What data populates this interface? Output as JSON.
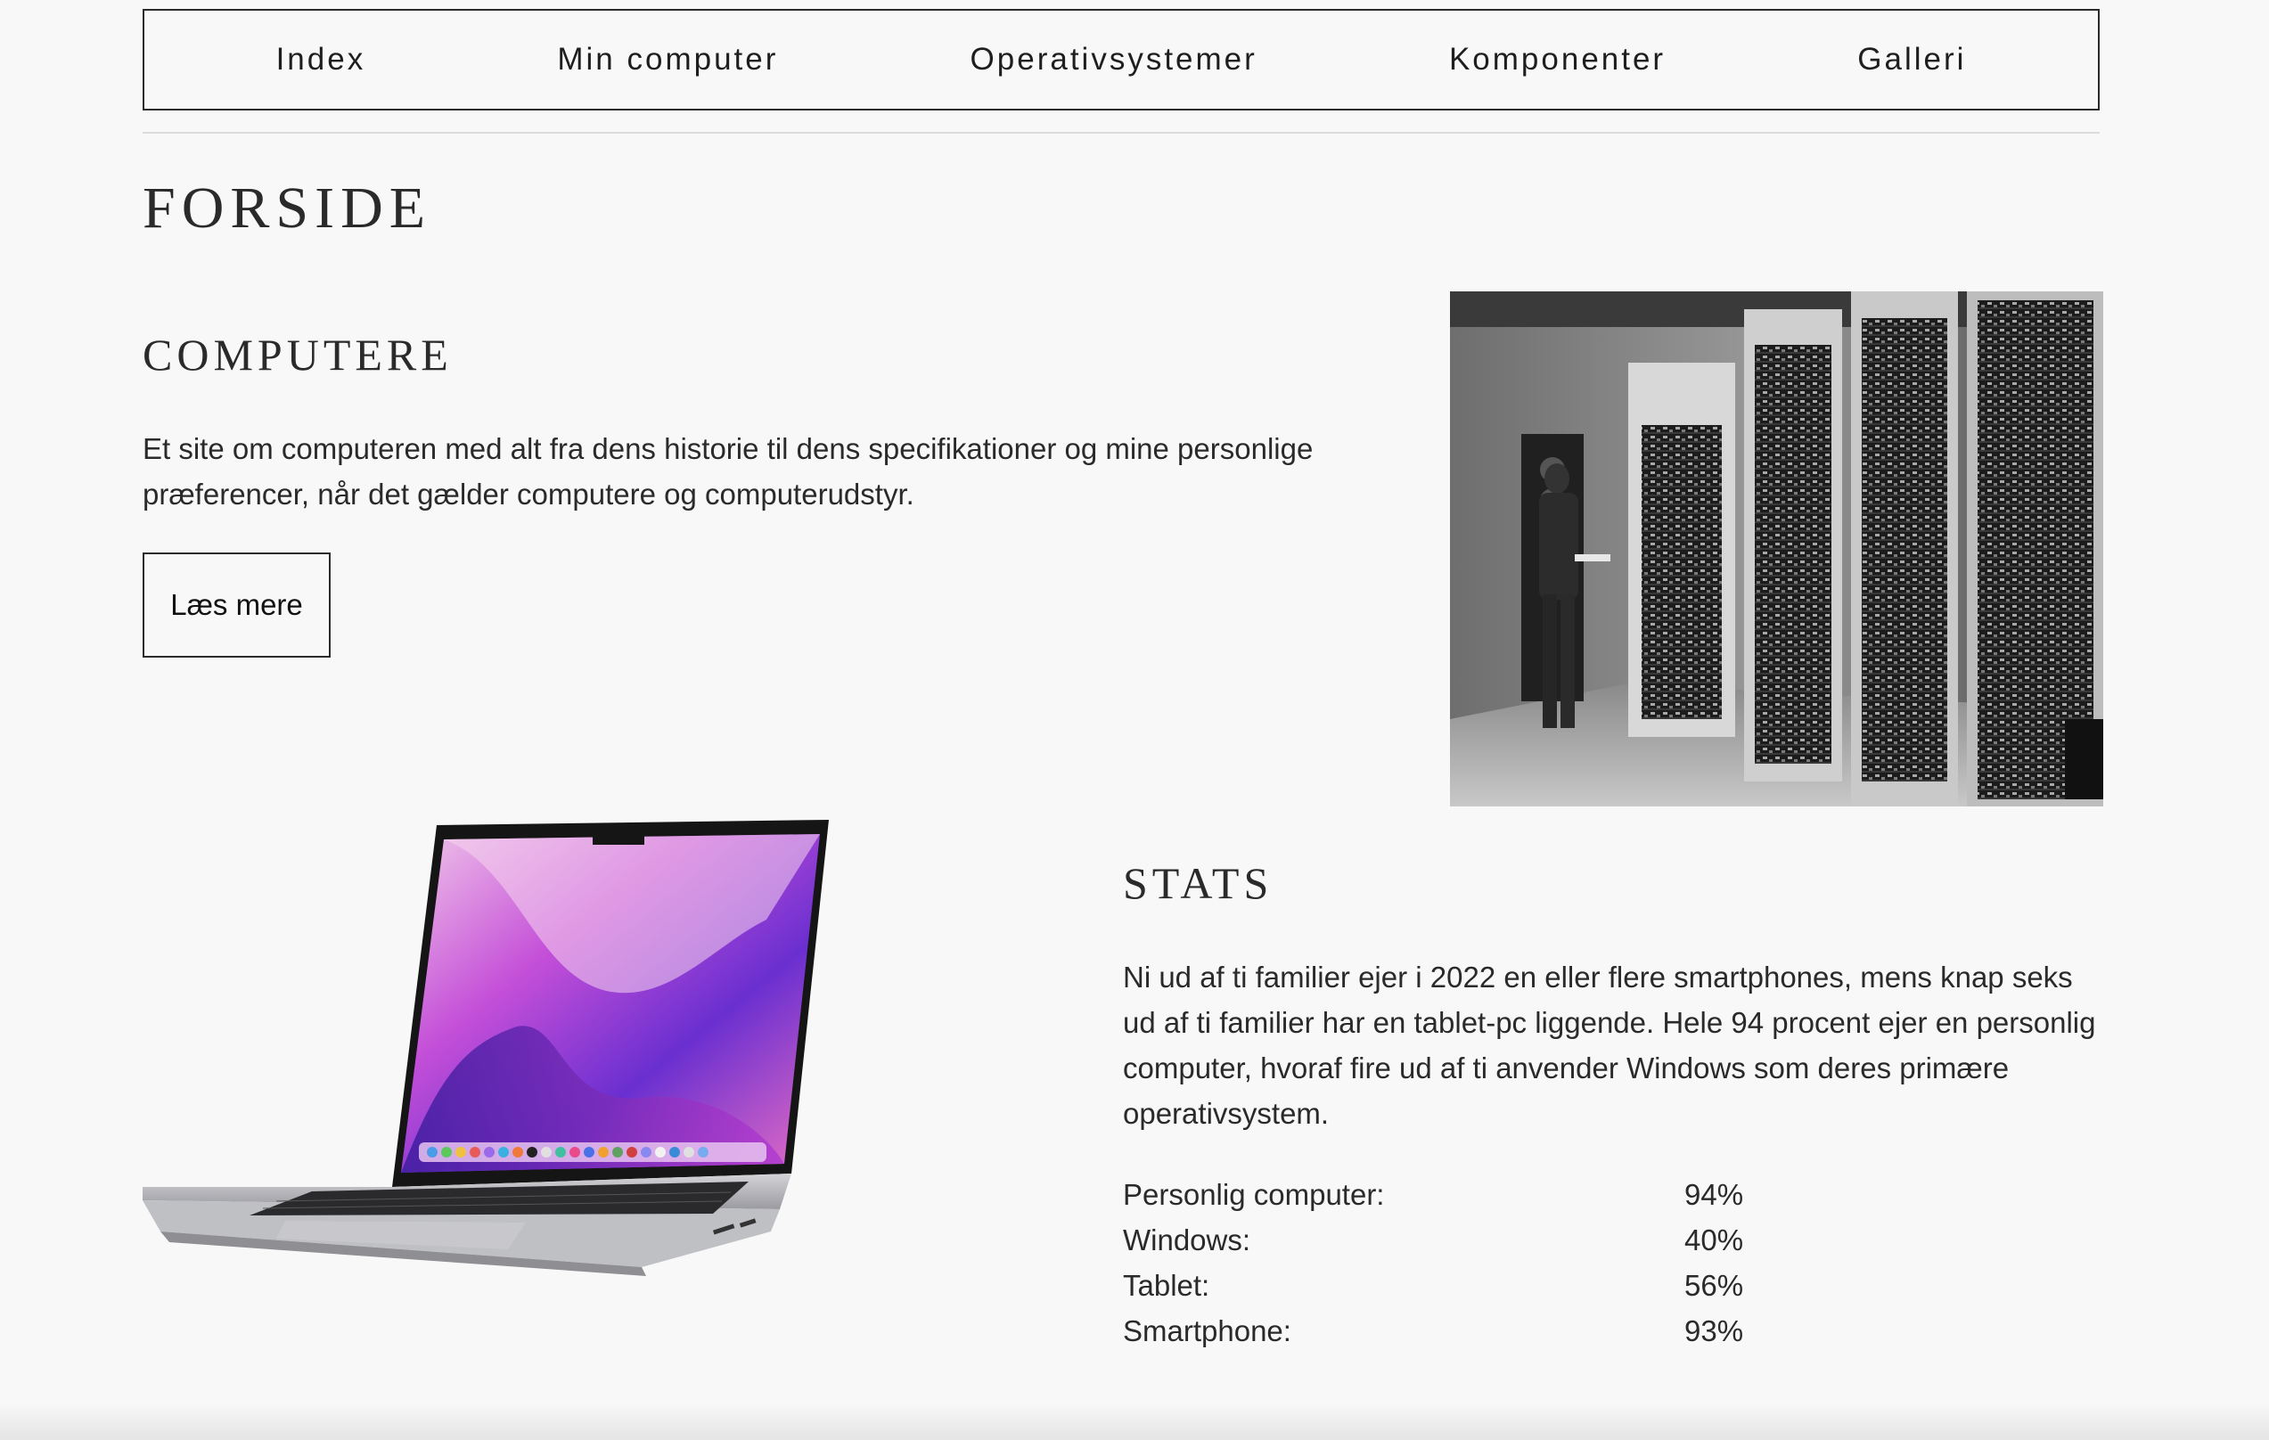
{
  "nav": {
    "items": [
      {
        "label": "Index"
      },
      {
        "label": "Min computer"
      },
      {
        "label": "Operativsystemer"
      },
      {
        "label": "Komponenter"
      },
      {
        "label": "Galleri"
      }
    ]
  },
  "page": {
    "title": "FORSIDE"
  },
  "computere": {
    "title": "COMPUTERE",
    "text": "Et site om computeren med alt fra dens historie til dens specifikationer og mine personlige præferencer, når det gælder computere og computerudstyr.",
    "button_label": "Læs mere"
  },
  "stats": {
    "title": "STATS",
    "text": "Ni ud af ti familier ejer i 2022 en eller flere smartphones, mens knap seks ud af ti familier har en tablet-pc liggende. Hele 94 procent ejer en personlig computer, hvoraf fire ud af ti anvender Windows som deres primære operativsystem.",
    "rows": [
      {
        "label": "Personlig computer:",
        "value": "94%"
      },
      {
        "label": "Windows:",
        "value": "40%"
      },
      {
        "label": "Tablet:",
        "value": "56%"
      },
      {
        "label": "Smartphone:",
        "value": "93%"
      }
    ]
  },
  "images": {
    "mainframe": "historic-mainframe-photo",
    "laptop": "laptop-photo"
  },
  "colors": {
    "background": "#f8f8f8",
    "text": "#2a2a2a",
    "border": "#2b2b2b",
    "accent_magenta": "#c44fd8",
    "accent_purple": "#6a2fd0"
  }
}
